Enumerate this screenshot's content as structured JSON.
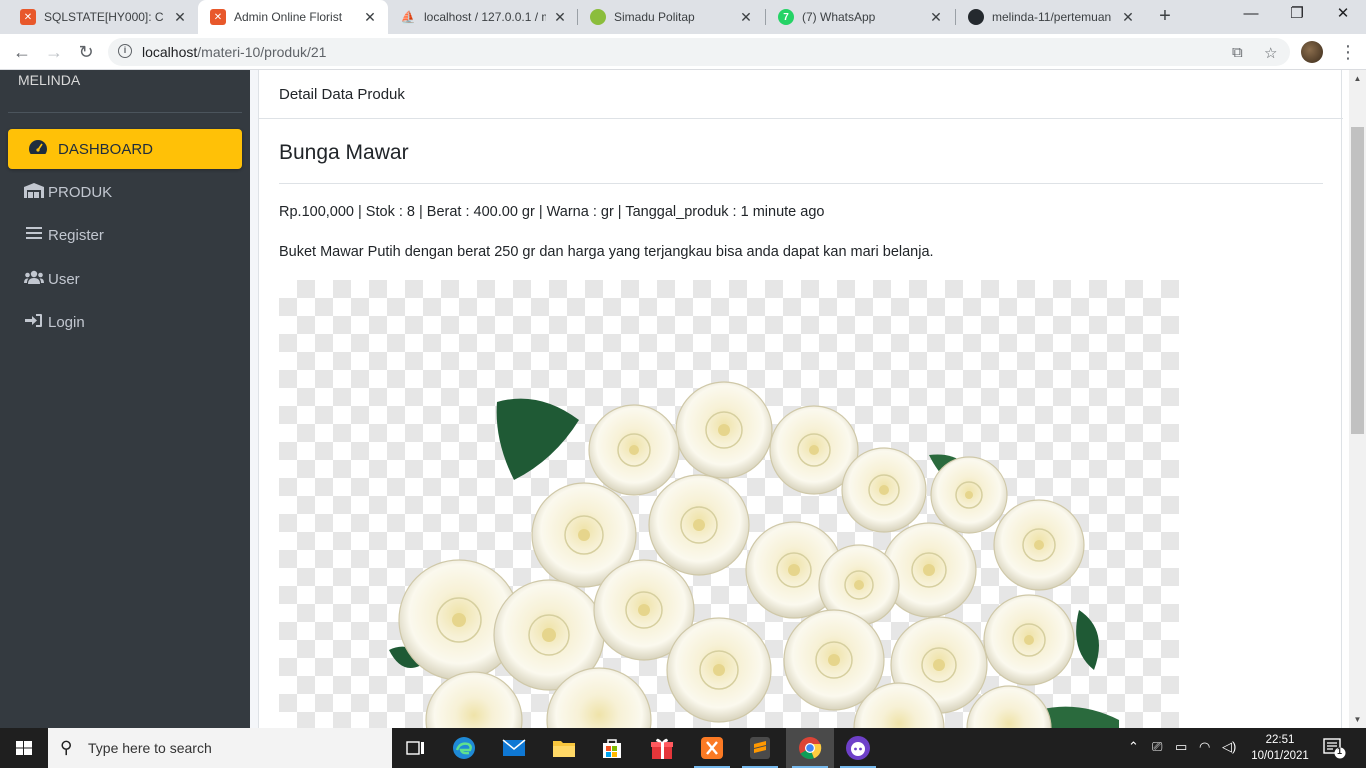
{
  "browser": {
    "tabs": [
      {
        "title": "SQLSTATE[HY000]: C",
        "active": false,
        "favicon_color": "#e8582b",
        "favicon_name": "xampp-icon"
      },
      {
        "title": "Admin Online Florist",
        "active": true,
        "favicon_color": "#e8582b",
        "favicon_name": "xampp-icon"
      },
      {
        "title": "localhost / 127.0.0.1 / m",
        "active": false,
        "favicon_color": "#f2a134",
        "favicon_name": "phpmyadmin-icon"
      },
      {
        "title": "Simadu Politap",
        "active": false,
        "favicon_color": "#8bbd3c",
        "favicon_name": "politap-icon"
      },
      {
        "title": "(7) WhatsApp",
        "active": false,
        "favicon_color": "#25d366",
        "favicon_name": "whatsapp-icon"
      },
      {
        "title": "melinda-11/pertemuan",
        "active": false,
        "favicon_color": "#24292e",
        "favicon_name": "github-icon"
      }
    ],
    "url_host": "localhost",
    "url_path": "/materi-10/produk/21"
  },
  "sidebar": {
    "brand": "MELINDA",
    "items": [
      {
        "label": "DASHBOARD",
        "icon": "tachometer-icon",
        "active": true
      },
      {
        "label": "PRODUK",
        "icon": "warehouse-icon",
        "active": false
      },
      {
        "label": "Register",
        "icon": "list-icon",
        "active": false
      },
      {
        "label": "User",
        "icon": "users-icon",
        "active": false
      },
      {
        "label": "Login",
        "icon": "sign-in-icon",
        "active": false
      }
    ]
  },
  "card": {
    "header": "Detail Data Produk",
    "product_title": "Bunga Mawar",
    "meta": "Rp.100,000 | Stok : 8 | Berat : 400.00 gr | Warna : gr | Tanggal_produk : 1 minute ago",
    "description": "Buket Mawar Putih dengan berat 250 gr dan harga yang terjangkau bisa anda dapat kan mari belanja."
  },
  "taskbar": {
    "search_placeholder": "Type here to search",
    "time": "22:51",
    "date": "10/01/2021",
    "notification_count": "1"
  }
}
